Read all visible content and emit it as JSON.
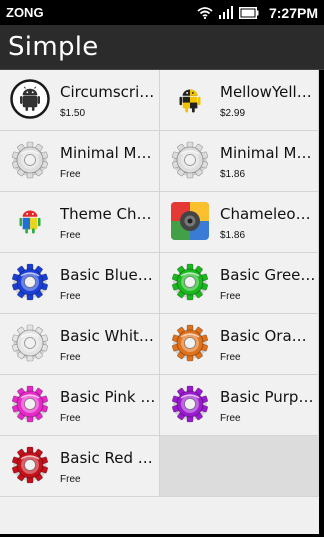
{
  "status": {
    "carrier": "ZONG",
    "time": "7:27PM",
    "icons": [
      "wifi-icon",
      "signal-icon",
      "battery-icon"
    ]
  },
  "header": {
    "title": "Simple"
  },
  "apps": [
    {
      "name": "Circumscribed Android",
      "price": "$1.50",
      "icon": "android-circle-icon"
    },
    {
      "name": "MellowYellow Android",
      "price": "$2.99",
      "icon": "android-yellow-icon"
    },
    {
      "name": "Minimal Mach",
      "price": "Free",
      "icon": "white-gear-icon",
      "color": "#dddddd"
    },
    {
      "name": "Minimal Mach",
      "price": "$1.86",
      "icon": "white-gear-icon",
      "color": "#dddddd"
    },
    {
      "name": "Theme Chooser",
      "price": "Free",
      "icon": "android-color-icon"
    },
    {
      "name": "Chameleon Launcher",
      "price": "$1.86",
      "icon": "chameleon-icon"
    },
    {
      "name": "Basic Blue for",
      "price": "Free",
      "icon": "blue-gear-icon",
      "color": "#1a3fd6"
    },
    {
      "name": "Basic Green for",
      "price": "Free",
      "icon": "green-gear-icon",
      "color": "#19b81c"
    },
    {
      "name": "Basic White for",
      "price": "Free",
      "icon": "white-gear-icon",
      "color": "#e4e4e4"
    },
    {
      "name": "Basic Orange for",
      "price": "Free",
      "icon": "orange-gear-icon",
      "color": "#e0701a"
    },
    {
      "name": "Basic Pink for",
      "price": "Free",
      "icon": "pink-gear-icon",
      "color": "#e629c8"
    },
    {
      "name": "Basic Purple for",
      "price": "Free",
      "icon": "purple-gear-icon",
      "color": "#9a1ad0"
    },
    {
      "name": "Basic Red for",
      "price": "Free",
      "icon": "red-gear-icon",
      "color": "#c4101a"
    }
  ]
}
